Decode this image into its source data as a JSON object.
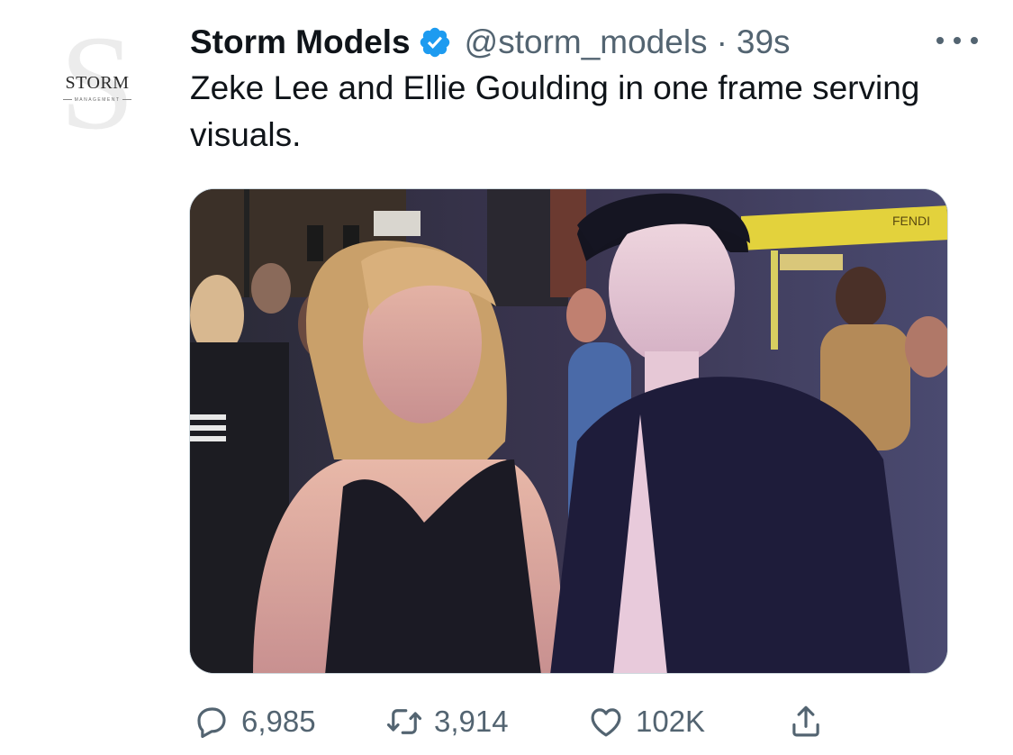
{
  "account": {
    "display_name": "Storm Models",
    "handle": "@storm_models",
    "separator": "·",
    "time": "39s",
    "avatar_word": "STORM",
    "avatar_sub": "MANAGEMENT",
    "avatar_letter": "S",
    "verified_icon": "verified-badge-icon"
  },
  "tweet": {
    "text": "Zeke Lee and Ellie Goulding in one frame serving visuals."
  },
  "media": {
    "sign_text": "FENDI",
    "description": "photo"
  },
  "actions": {
    "reply_count": "6,985",
    "retweet_count": "3,914",
    "like_count": "102K",
    "icons": [
      "reply-icon",
      "retweet-icon",
      "like-icon",
      "share-icon"
    ]
  },
  "colors": {
    "verified": "#1d9bf0",
    "muted": "#536471",
    "text": "#0f1419"
  }
}
